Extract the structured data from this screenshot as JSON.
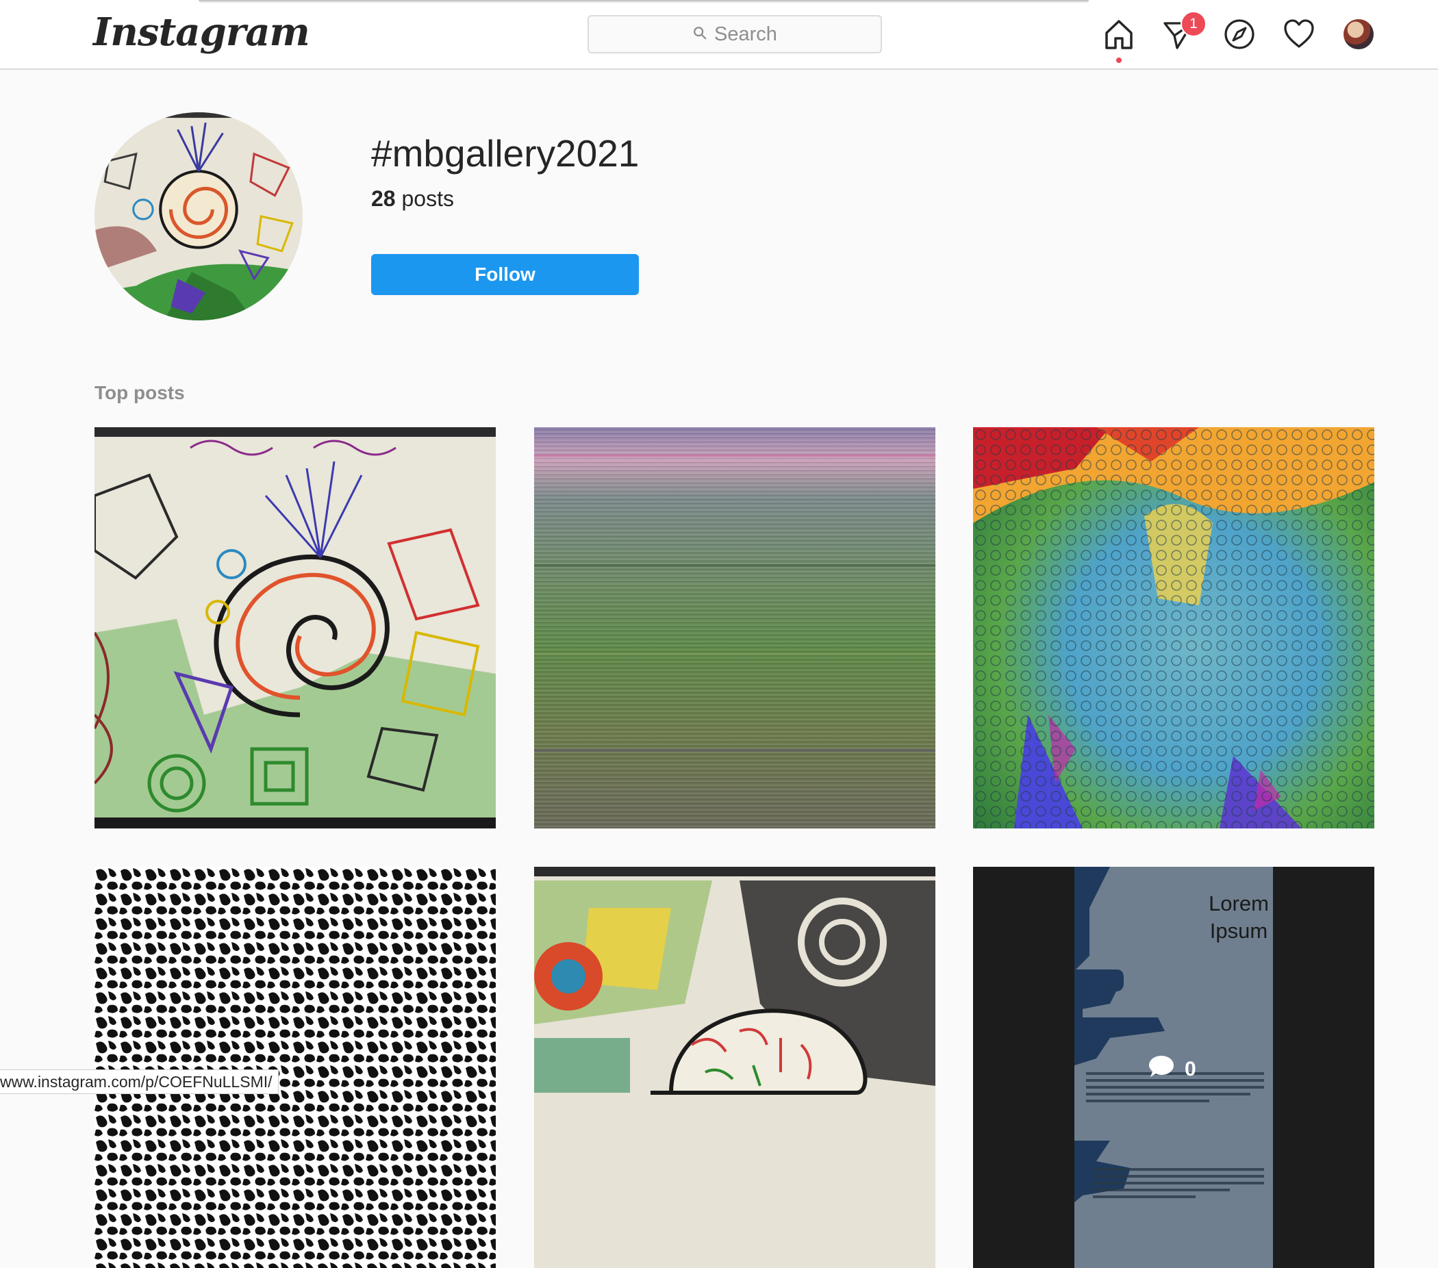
{
  "header": {
    "logo_text": "Instagram",
    "search_placeholder": "Search",
    "notification_count": "1",
    "icons": [
      "home-icon",
      "direct-message-icon",
      "explore-compass-icon",
      "activity-heart-icon",
      "profile-avatar"
    ]
  },
  "profile": {
    "hashtag": "#mbgallery2021",
    "posts_number": "28",
    "posts_label": "posts",
    "follow_label": "Follow"
  },
  "top_posts": {
    "section_label": "Top posts",
    "tile6": {
      "title_line1": "Lorem",
      "title_line2": "Ipsum",
      "comment_count": "0"
    }
  },
  "status_bar": {
    "url": "www.instagram.com/p/COEFNuLLSMI/"
  },
  "colors": {
    "follow_button": "#1c97f0",
    "notification_badge": "#ed4956",
    "background": "#fafafa",
    "text": "#262626",
    "secondary_text": "#8e8e8e"
  }
}
